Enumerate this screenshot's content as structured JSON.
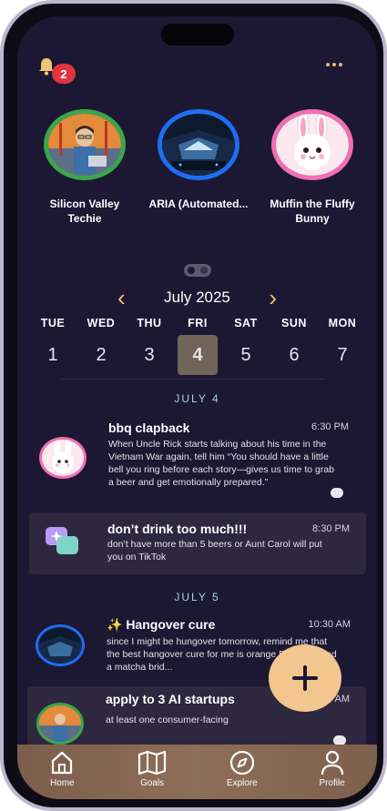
{
  "notifications": {
    "count": "2"
  },
  "bots": [
    {
      "name": "Silicon Valley Techie",
      "ring": "#3aa649"
    },
    {
      "name": "ARIA (Automated...",
      "ring": "#1f6ef2"
    },
    {
      "name": "Muffin the Fluffy Bunny",
      "ring": "#f06fb1"
    }
  ],
  "calendar": {
    "month": "July 2025",
    "days": [
      {
        "name": "TUE",
        "num": "1"
      },
      {
        "name": "WED",
        "num": "2"
      },
      {
        "name": "THU",
        "num": "3"
      },
      {
        "name": "FRI",
        "num": "4",
        "selected": true
      },
      {
        "name": "SAT",
        "num": "5"
      },
      {
        "name": "SUN",
        "num": "6"
      },
      {
        "name": "MON",
        "num": "7"
      }
    ]
  },
  "groups": [
    {
      "date": "JULY 4",
      "items": [
        {
          "title": "bbq clapback",
          "time": "6:30 PM",
          "body": "When Uncle Rick starts talking about his time in the Vietnam War again, tell him “You should have a little bell you ring before each story—gives us time to grab a beer and get emotionally prepared.”"
        },
        {
          "title": "don’t drink too much!!!",
          "time": "8:30 PM",
          "body": "don’t have more than 5 beers or Aunt Carol will put you on TikTok"
        }
      ]
    },
    {
      "date": "JULY 5",
      "items": [
        {
          "title": "✨ Hangover cure",
          "time": "10:30 AM",
          "body": "since I might be hungover tomorrow, remind me that the best hangover cure for me is orange Pedialyte and a matcha brid..."
        },
        {
          "title": "apply to 3 AI startups",
          "time": "10:45 AM",
          "body": "at least one consumer-facing"
        }
      ]
    }
  ],
  "nav": [
    {
      "label": "Home",
      "icon": "home-icon"
    },
    {
      "label": "Goals",
      "icon": "map-icon"
    },
    {
      "label": "Explore",
      "icon": "compass-icon"
    },
    {
      "label": "Profile",
      "icon": "person-icon"
    }
  ],
  "colors": {
    "accent": "#f3c071",
    "background": "#1c1733",
    "fab": "#f3c58f",
    "badge": "#e0343f"
  }
}
